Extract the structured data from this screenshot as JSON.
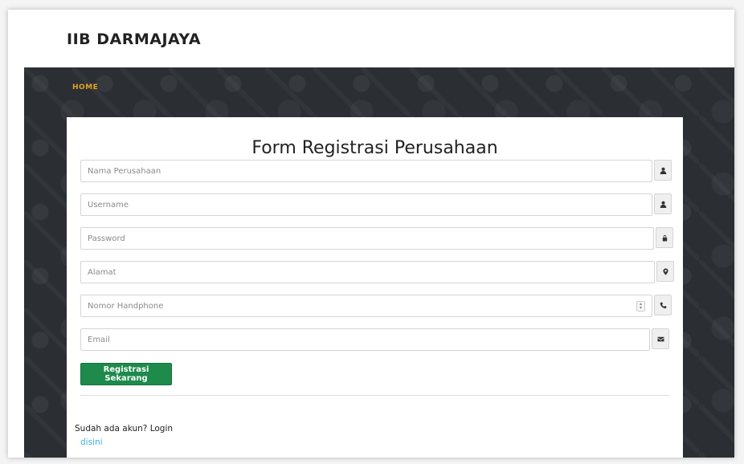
{
  "brand": {
    "title": "IIB DARMAJAYA"
  },
  "nav": {
    "home_label": "HOME"
  },
  "form": {
    "title": "Form Registrasi Perusahaan",
    "fields": [
      {
        "placeholder": "Nama Perusahaan",
        "value": "",
        "icon": "user-icon"
      },
      {
        "placeholder": "Username",
        "value": "",
        "icon": "user-icon"
      },
      {
        "placeholder": "Password",
        "value": "",
        "icon": "lock-icon"
      },
      {
        "placeholder": "Alamat",
        "value": "",
        "icon": "map-marker-icon"
      },
      {
        "placeholder": "Nomor Handphone",
        "value": "",
        "icon": "phone-icon"
      },
      {
        "placeholder": "Email",
        "value": "",
        "icon": "envelope-icon"
      }
    ],
    "submit_label": "Registrasi Sekarang"
  },
  "login": {
    "prompt": "Sudah ada akun? Login",
    "link_label": "disini"
  },
  "colors": {
    "hero_bg": "#2b2e33",
    "nav_accent": "#e0a422",
    "submit_bg": "#1e8a4c",
    "link": "#3bb0d8"
  }
}
